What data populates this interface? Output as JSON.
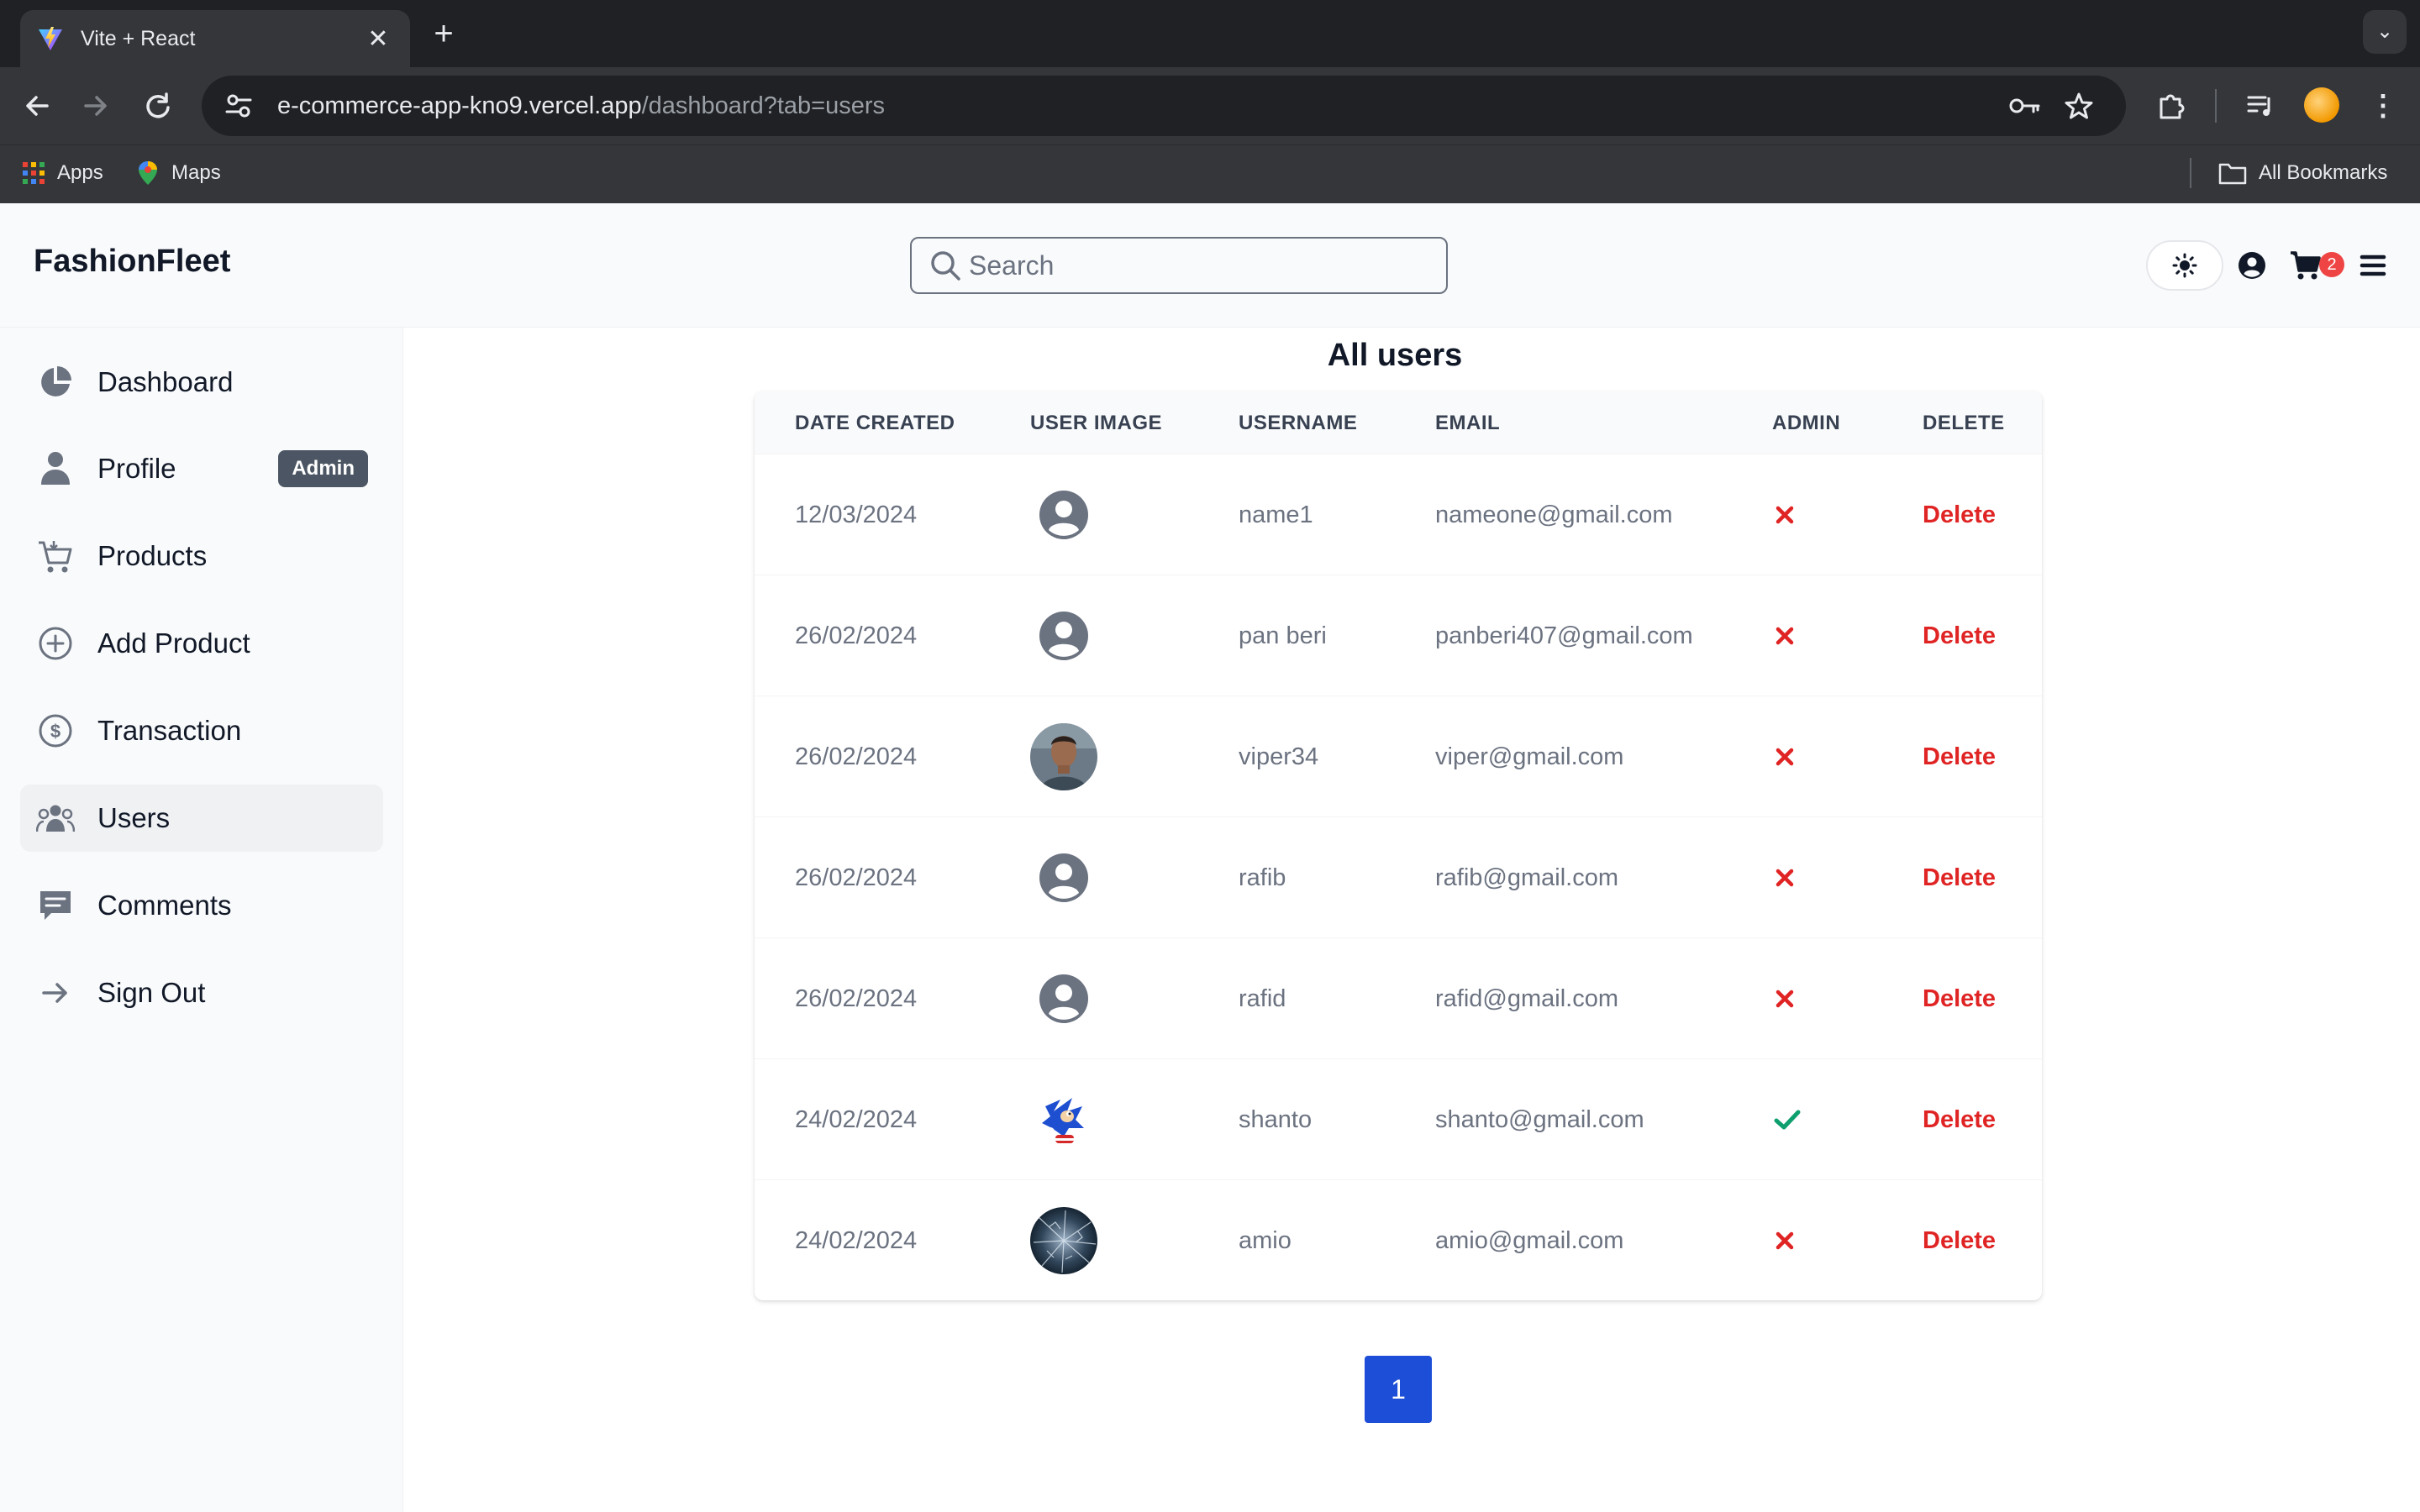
{
  "browser": {
    "tab_title": "Vite + React",
    "url_host": "e-commerce-app-kno9.vercel.app",
    "url_path": "/dashboard?tab=users",
    "bookmarks": [
      {
        "label": "Apps",
        "icon": "apps-grid-icon"
      },
      {
        "label": "Maps",
        "icon": "maps-pin-icon"
      }
    ],
    "all_bookmarks_label": "All Bookmarks"
  },
  "header": {
    "brand": "FashionFleet",
    "search_placeholder": "Search",
    "cart_count": "2"
  },
  "sidebar": {
    "items": [
      {
        "label": "Dashboard",
        "icon": "pie-chart-icon"
      },
      {
        "label": "Profile",
        "icon": "user-icon",
        "badge": "Admin"
      },
      {
        "label": "Products",
        "icon": "cart-icon"
      },
      {
        "label": "Add Product",
        "icon": "plus-circle-icon"
      },
      {
        "label": "Transaction",
        "icon": "dollar-circle-icon"
      },
      {
        "label": "Users",
        "icon": "users-group-icon",
        "active": true
      },
      {
        "label": "Comments",
        "icon": "comment-icon"
      },
      {
        "label": "Sign Out",
        "icon": "arrow-right-icon"
      }
    ]
  },
  "main": {
    "title": "All users",
    "columns": [
      "DATE CREATED",
      "USER IMAGE",
      "USERNAME",
      "EMAIL",
      "ADMIN",
      "DELETE"
    ],
    "rows": [
      {
        "date": "12/03/2024",
        "avatar": "default",
        "username": "name1",
        "email": "nameone@gmail.com",
        "admin": false,
        "delete": "Delete"
      },
      {
        "date": "26/02/2024",
        "avatar": "default",
        "username": "pan beri",
        "email": "panberi407@gmail.com",
        "admin": false,
        "delete": "Delete"
      },
      {
        "date": "26/02/2024",
        "avatar": "photo-man",
        "username": "viper34",
        "email": "viper@gmail.com",
        "admin": false,
        "delete": "Delete"
      },
      {
        "date": "26/02/2024",
        "avatar": "default",
        "username": "rafib",
        "email": "rafib@gmail.com",
        "admin": false,
        "delete": "Delete"
      },
      {
        "date": "26/02/2024",
        "avatar": "default",
        "username": "rafid",
        "email": "rafid@gmail.com",
        "admin": false,
        "delete": "Delete"
      },
      {
        "date": "24/02/2024",
        "avatar": "photo-sonic",
        "username": "shanto",
        "email": "shanto@gmail.com",
        "admin": true,
        "delete": "Delete"
      },
      {
        "date": "24/02/2024",
        "avatar": "photo-glass",
        "username": "amio",
        "email": "amio@gmail.com",
        "admin": false,
        "delete": "Delete"
      }
    ],
    "pagination": {
      "current": "1"
    }
  },
  "colors": {
    "accent": "#1d4ed8",
    "danger": "#e02424",
    "success": "#0e9f6e",
    "sidebar_bg": "#f9fafb",
    "badge_bg": "#4b5563"
  }
}
